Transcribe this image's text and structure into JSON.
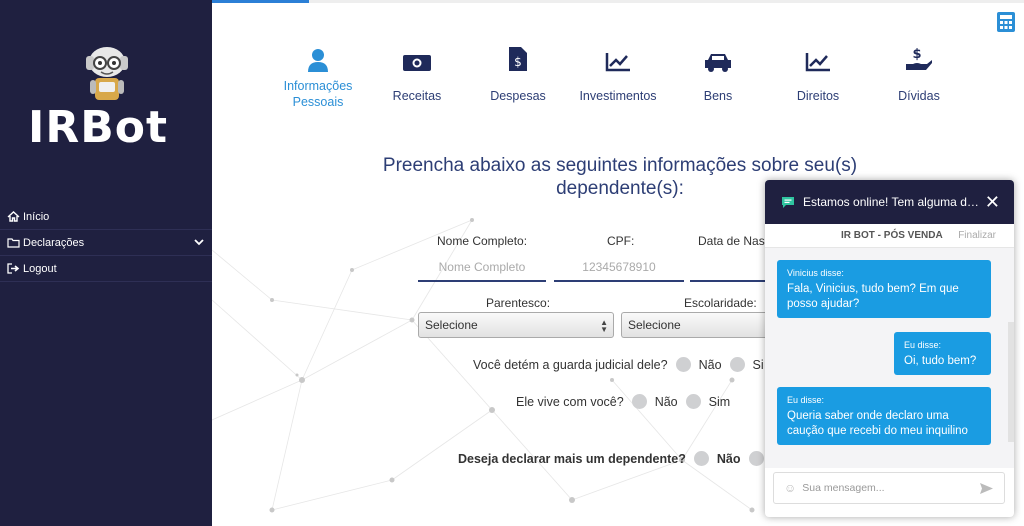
{
  "sidebar": {
    "logo_text": "IRBot",
    "items": [
      {
        "label": "Início",
        "icon": "home-icon"
      },
      {
        "label": "Declarações",
        "icon": "folder-icon"
      },
      {
        "label": "Logout",
        "icon": "sign-out-icon"
      }
    ]
  },
  "progress": {
    "value": 0.12
  },
  "steps": [
    {
      "label": "Informações Pessoais",
      "icon": "user-icon",
      "active": true
    },
    {
      "label": "Receitas",
      "icon": "money-icon",
      "active": false
    },
    {
      "label": "Despesas",
      "icon": "invoice-dollar-icon",
      "active": false
    },
    {
      "label": "Investimentos",
      "icon": "chart-line-icon",
      "active": false
    },
    {
      "label": "Bens",
      "icon": "car-icon",
      "active": false
    },
    {
      "label": "Direitos",
      "icon": "chart-line-icon",
      "active": false
    },
    {
      "label": "Dívidas",
      "icon": "hand-dollar-icon",
      "active": false
    }
  ],
  "form": {
    "heading_line1": "Preencha abaixo as seguintes informações sobre seu(s)",
    "heading_line2": "dependente(s):",
    "nome_label": "Nome Completo:",
    "nome_placeholder": "Nome Completo",
    "cpf_label": "CPF:",
    "cpf_placeholder": "12345678910",
    "data_label": "Data de Nasc",
    "parentesco_label": "Parentesco:",
    "parentesco_value": "Selecione",
    "escolaridade_label": "Escolaridade:",
    "escolaridade_value": "Selecione",
    "q1": "Você detém a guarda judicial dele?",
    "q2": "Ele vive com você?",
    "q3": "Deseja declarar mais um dependente?",
    "nao": "Não",
    "sim": "Sim",
    "sim_cut": "Si"
  },
  "chat": {
    "header": "Estamos online! Tem alguma dúvida?",
    "agent": "IR BOT - PÓS VENDA",
    "finalize": "Finalizar",
    "messages": [
      {
        "who": "Vinicius disse:",
        "text": "Fala, Vinicius, tudo bem? Em que posso ajudar?"
      },
      {
        "who": "Eu disse:",
        "text": "Oi, tudo bem?"
      },
      {
        "who": "Eu disse:",
        "text": "Queria saber onde declaro uma caução que recebi do meu inquilino"
      }
    ],
    "input_placeholder": "Sua mensagem..."
  },
  "colors": {
    "sidebar": "#1f2040",
    "accent": "#2b8fd6",
    "navy": "#2d3e75",
    "chat_bubble": "#1a9ce2"
  }
}
